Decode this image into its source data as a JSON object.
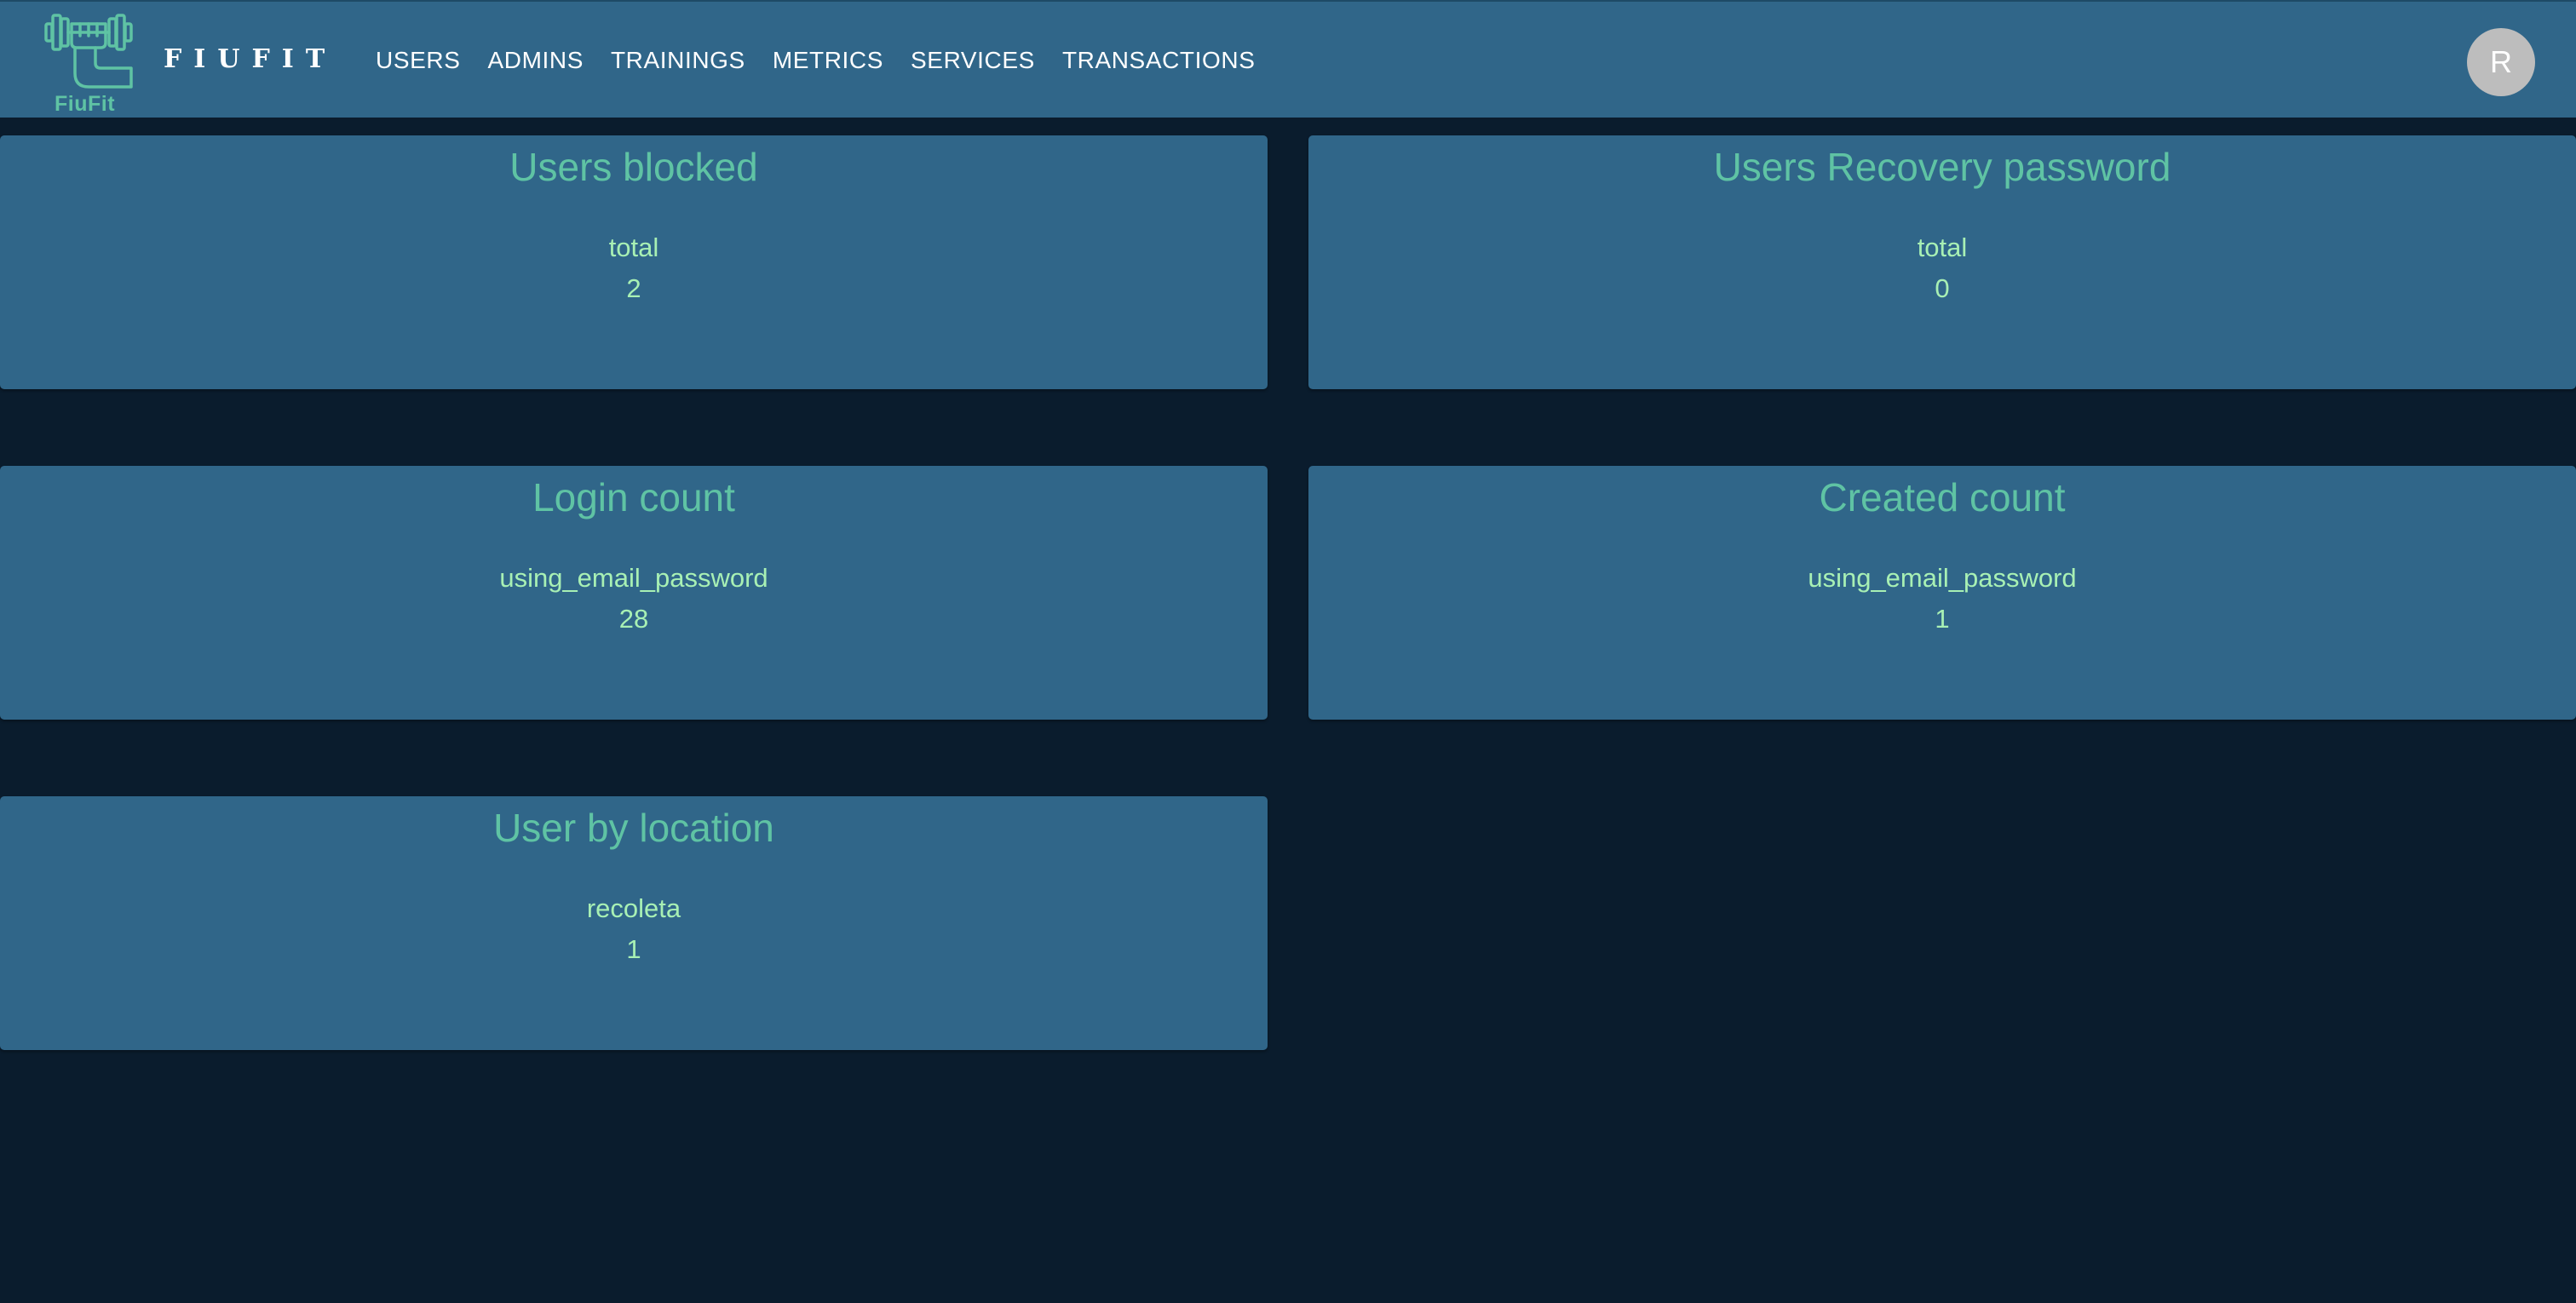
{
  "header": {
    "logo_text": "FiuFit",
    "brand": "FIUFIT",
    "nav": [
      "USERS",
      "ADMINS",
      "TRAININGS",
      "METRICS",
      "SERVICES",
      "TRANSACTIONS"
    ],
    "avatar_initial": "R"
  },
  "cards": [
    {
      "title": "Users blocked",
      "label": "total",
      "value": "2"
    },
    {
      "title": "Users Recovery password",
      "label": "total",
      "value": "0"
    },
    {
      "title": "Login count",
      "label": "using_email_password",
      "value": "28"
    },
    {
      "title": "Created count",
      "label": "using_email_password",
      "value": "1"
    },
    {
      "title": "User by location",
      "label": "recoleta",
      "value": "1"
    }
  ],
  "colors": {
    "appbar": "#306689",
    "background": "#0a1c2d",
    "card": "#306689",
    "title_accent": "#5fc3a4",
    "metric_text": "#a8f0b4"
  }
}
